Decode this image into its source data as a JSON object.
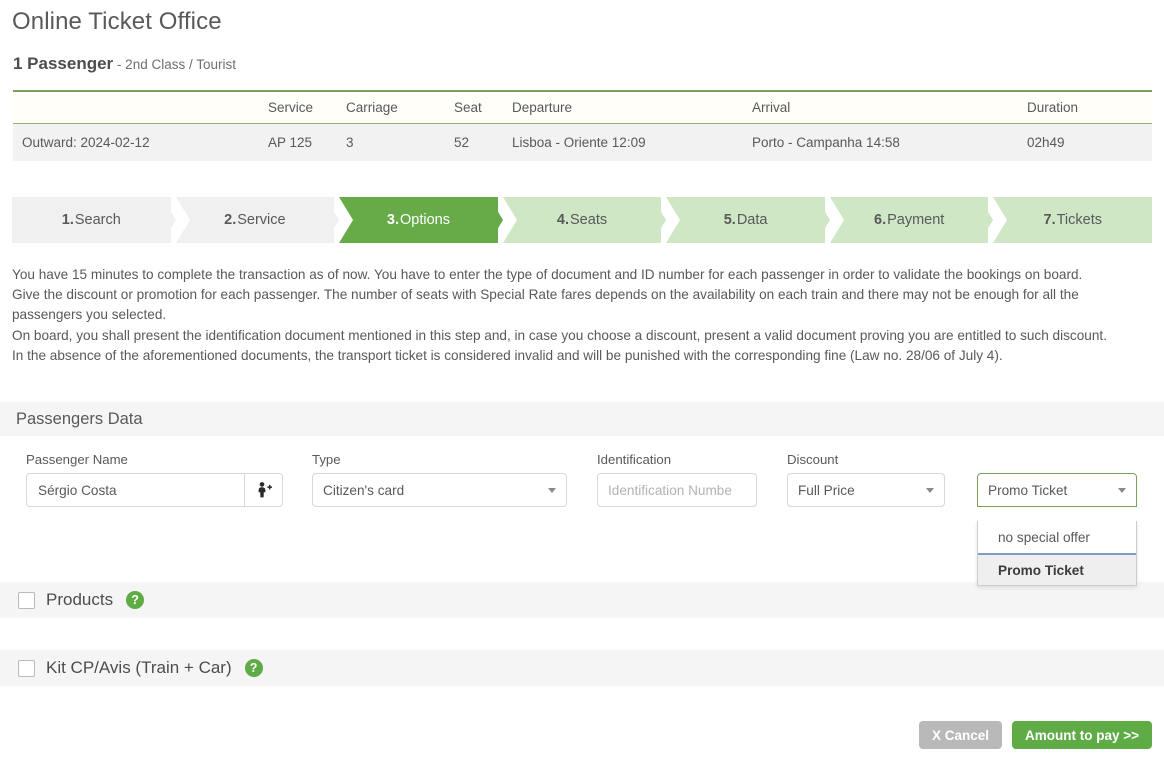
{
  "header": {
    "app_title": "Online Ticket Office",
    "passenger_count": "1 Passenger",
    "class_info": " - 2nd Class / Tourist"
  },
  "trip_table": {
    "columns": [
      "",
      "Service",
      "Carriage",
      "Seat",
      "Departure",
      "Arrival",
      "Duration"
    ],
    "rows": [
      {
        "date": "Outward: 2024-02-12",
        "service": "AP 125",
        "carriage": "3",
        "seat": "52",
        "departure": "Lisboa - Oriente 12:09",
        "arrival": "Porto - Campanha 14:58",
        "duration": "02h49"
      }
    ]
  },
  "wizard": {
    "steps": [
      {
        "num": "1.",
        "label": "Search",
        "state": "done"
      },
      {
        "num": "2.",
        "label": "Service",
        "state": "done"
      },
      {
        "num": "3.",
        "label": "Options",
        "state": "current"
      },
      {
        "num": "4.",
        "label": "Seats",
        "state": "todo"
      },
      {
        "num": "5.",
        "label": "Data",
        "state": "todo"
      },
      {
        "num": "6.",
        "label": "Payment",
        "state": "todo"
      },
      {
        "num": "7.",
        "label": "Tickets",
        "state": "todo"
      }
    ],
    "active_color": "#67ab49",
    "todo_color": "#cfe7c4",
    "done_color": "#f0f0f0"
  },
  "info": {
    "p1": "You have 15 minutes to complete the transaction as of now. You have to enter the type of document and ID number for each passenger in order to validate the bookings on board.",
    "p2": "Give the discount or promotion for each passenger. The number of seats with Special Rate fares depends on the availability on each train and there may not be enough for all the passengers you selected.",
    "p3": "On board, you shall present the identification document mentioned in this step and, in case you choose a discount, present a valid document proving you are entitled to such discount.",
    "p4": "In the absence of the aforementioned documents, the transport ticket is considered invalid and will be punished with the corresponding fine (Law no. 28/06 of July 4)."
  },
  "passengers_data": {
    "section_title": "Passengers Data",
    "labels": {
      "name": "Passenger Name",
      "type": "Type",
      "identification": "Identification",
      "discount": "Discount"
    },
    "name_value": "Sérgio Costa",
    "add_passenger_icon": "person-add-icon",
    "type_value": "Citizen's card",
    "identification_placeholder": "Identification Numbe",
    "identification_value": "",
    "discount_value": "Full Price",
    "promo_value": "Promo Ticket",
    "promo_open": true,
    "promo_options": [
      {
        "label": "no special offer",
        "selected": false
      },
      {
        "label": "Promo Ticket",
        "selected": true
      }
    ]
  },
  "options": {
    "products_label": "Products",
    "products_checked": false,
    "kit_label": "Kit CP/Avis (Train + Car)",
    "kit_checked": false,
    "help_glyph": "?"
  },
  "footer": {
    "cancel_label": "X Cancel",
    "pay_label": "Amount to pay >>",
    "cancel_color": "#b9b9b9",
    "pay_color": "#5fab46"
  }
}
